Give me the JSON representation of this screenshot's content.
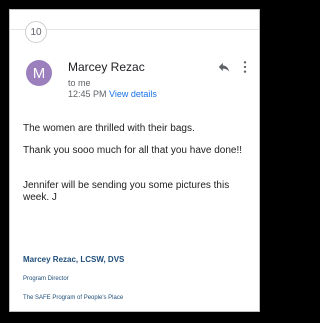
{
  "thread": {
    "message_count": "10"
  },
  "message": {
    "avatar_letter": "M",
    "sender": "Marcey Rezac",
    "to": "to me",
    "time": "12:45 PM",
    "view_details": "View details",
    "body": [
      "The women are thrilled with their bags.",
      "Thank you sooo much for all that you have done!!",
      "Jennifer will be sending you some pictures this week.  J"
    ],
    "signature": {
      "name": "Marcey Rezac, LCSW, DVS",
      "role": "Program Director",
      "org": "The SAFE Program of People's Place"
    }
  },
  "colors": {
    "avatar": "#9c7fbd",
    "link": "#1a73e8",
    "signature": "#1f4e79"
  },
  "icons": {
    "reply": "reply-icon",
    "more": "more-vert-icon"
  }
}
